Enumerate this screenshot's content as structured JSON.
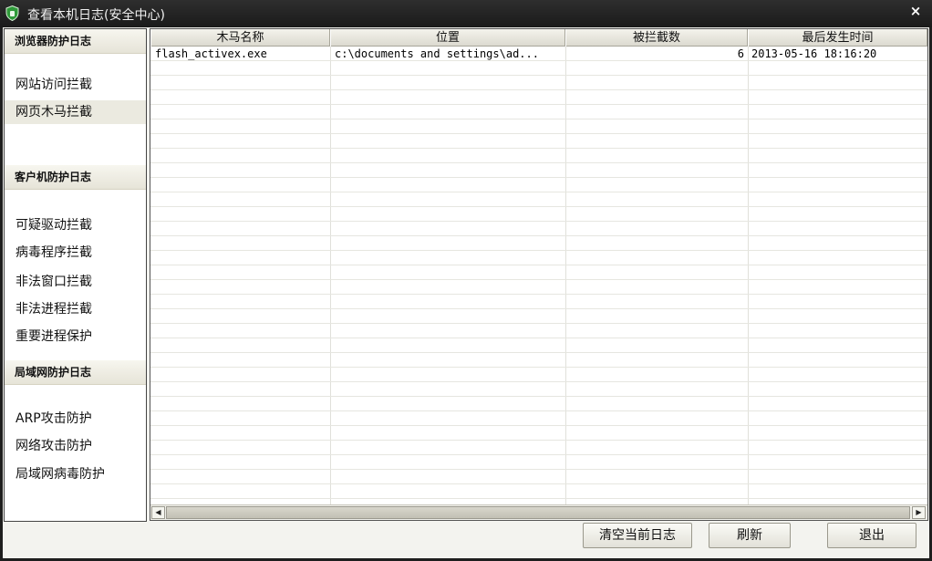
{
  "window": {
    "title": "查看本机日志(安全中心)",
    "close_label": "×",
    "app_icon": "shield-icon"
  },
  "sidebar": {
    "sections": [
      {
        "heading": "浏览器防护日志",
        "items": [
          {
            "label": "网站访问拦截",
            "selected": false
          },
          {
            "label": "网页木马拦截",
            "selected": true
          }
        ]
      },
      {
        "heading": "客户机防护日志",
        "items": [
          {
            "label": "可疑驱动拦截",
            "selected": false
          },
          {
            "label": "病毒程序拦截",
            "selected": false
          },
          {
            "label": "非法窗口拦截",
            "selected": false
          },
          {
            "label": "非法进程拦截",
            "selected": false
          },
          {
            "label": "重要进程保护",
            "selected": false
          }
        ]
      },
      {
        "heading": "局域网防护日志",
        "items": [
          {
            "label": "ARP攻击防护",
            "selected": false
          },
          {
            "label": "网络攻击防护",
            "selected": false
          },
          {
            "label": "局域网病毒防护",
            "selected": false
          }
        ]
      }
    ]
  },
  "table": {
    "columns": [
      "木马名称",
      "位置",
      "被拦截数",
      "最后发生时间"
    ],
    "rows": [
      [
        "flash_activex.exe",
        "c:\\documents and settings\\ad...",
        "6",
        "2013-05-16 18:16:20"
      ]
    ]
  },
  "scrollbar": {
    "left_icon": "arrow-left-icon",
    "right_icon": "arrow-right-icon"
  },
  "buttons": {
    "clear": "清空当前日志",
    "refresh": "刷新",
    "exit": "退出"
  }
}
